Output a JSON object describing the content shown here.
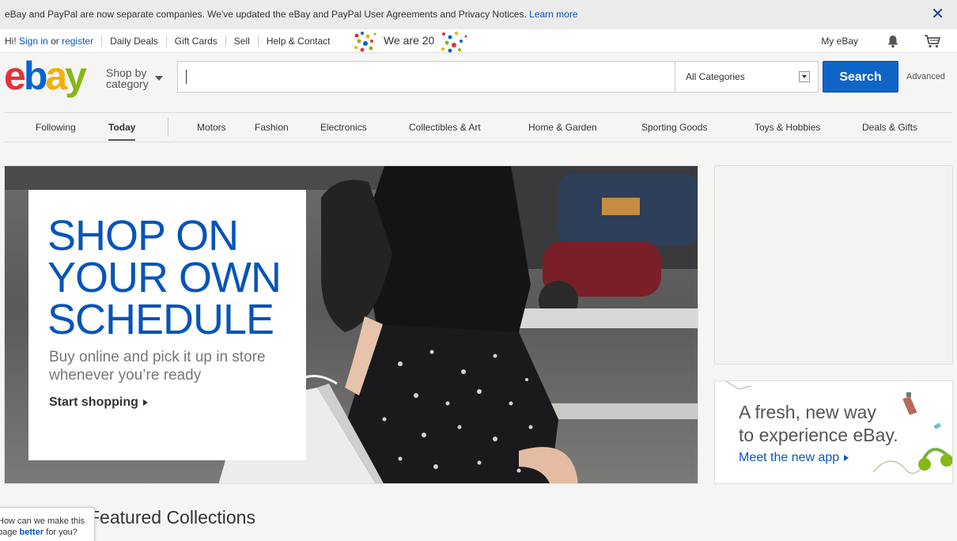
{
  "notice": {
    "text": "eBay and PayPal are now separate companies. We've updated the eBay and PayPal User Agreements and Privacy Notices.",
    "link": "Learn more",
    "close_icon": "close-icon"
  },
  "util": {
    "greeting": "Hi!",
    "sign_in": "Sign in",
    "or": "or",
    "register": "register",
    "links": [
      "Daily Deals",
      "Gift Cards",
      "Sell",
      "Help & Contact"
    ],
    "promo": "We are 20",
    "my_ebay": "My eBay",
    "bell_icon": "bell-icon",
    "cart_icon": "cart-icon"
  },
  "header": {
    "logo_letters": [
      "e",
      "b",
      "a",
      "y"
    ],
    "shop_by_line1": "Shop by",
    "shop_by_line2": "category",
    "search_placeholder": "",
    "category_select": "All Categories",
    "search_button": "Search",
    "advanced": "Advanced"
  },
  "nav": {
    "items": [
      "Following",
      "Today",
      "Motors",
      "Fashion",
      "Electronics",
      "Collectibles & Art",
      "Home & Garden",
      "Sporting Goods",
      "Toys & Hobbies",
      "Deals & Gifts"
    ],
    "active": "Today"
  },
  "hero": {
    "headline": [
      "SHOP ON",
      "YOUR OWN",
      "SCHEDULE"
    ],
    "sub": "Buy online and pick it up in store whenever you’re ready",
    "cta": "Start shopping"
  },
  "app_promo": {
    "line1": "A fresh, new way",
    "line2": "to experience eBay.",
    "link": "Meet the new app"
  },
  "featured": {
    "title": "Featured Collections"
  },
  "feedback": {
    "line1": "How can we make this",
    "line2_pre": "page",
    "line2_link": "better",
    "line2_post": "for you?"
  },
  "colors": {
    "link_blue": "#0654ba",
    "search_blue": "#0f64c8",
    "logo_red": "#e53238",
    "logo_blue": "#0064d2",
    "logo_yellow": "#f5af02",
    "logo_green": "#86b817"
  }
}
